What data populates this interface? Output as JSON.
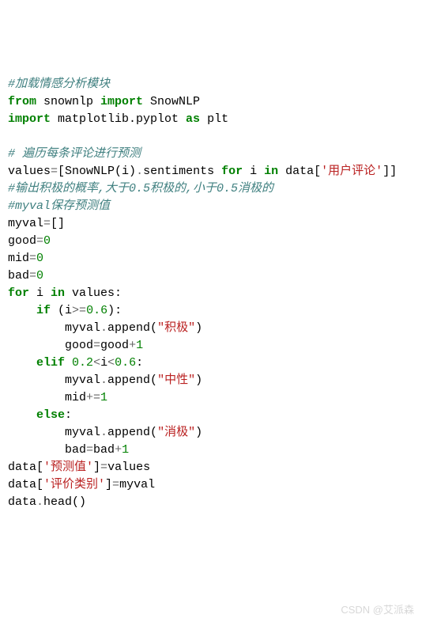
{
  "code": {
    "line1_comment": "#加载情感分析模块",
    "line2_from": "from",
    "line2_mod1": " snownlp ",
    "line2_import": "import",
    "line2_mod2": " SnowNLP",
    "line3_import": "import",
    "line3_rest": " matplotlib.pyplot ",
    "line3_as": "as",
    "line3_alias": " plt",
    "line5_comment": "# 遍历每条评论进行预测",
    "line6_a": "values",
    "line6_eq": "=",
    "line6_b": "[SnowNLP(i)",
    "line6_dot": ".",
    "line6_c": "sentiments ",
    "line6_for": "for",
    "line6_d": " i ",
    "line6_in": "in",
    "line6_e": " data[",
    "line6_str": "'用户评论'",
    "line6_f": "]]",
    "line7_comment": "#输出积极的概率,大于0.5积极的,小于0.5消极的",
    "line8_comment": "#myval保存预测值",
    "line9_a": "myval",
    "line9_eq": "=",
    "line9_b": "[]",
    "line10_a": "good",
    "line10_eq": "=",
    "line10_b": "0",
    "line11_a": "mid",
    "line11_eq": "=",
    "line11_b": "0",
    "line12_a": "bad",
    "line12_eq": "=",
    "line12_b": "0",
    "line13_for": "for",
    "line13_a": " i ",
    "line13_in": "in",
    "line13_b": " values:",
    "line14_if": "if",
    "line14_a": " (i",
    "line14_op": ">=",
    "line14_num": "0.6",
    "line14_b": "):",
    "line15_a": "myval",
    "line15_dot": ".",
    "line15_b": "append(",
    "line15_str": "\"积极\"",
    "line15_c": ")",
    "line16_a": "good",
    "line16_eq": "=",
    "line16_b": "good",
    "line16_plus": "+",
    "line16_num": "1",
    "line17_elif": "elif",
    "line17_a": " ",
    "line17_num1": "0.2",
    "line17_op1": "<",
    "line17_b": "i",
    "line17_op2": "<",
    "line17_num2": "0.6",
    "line17_c": ":",
    "line18_a": "myval",
    "line18_dot": ".",
    "line18_b": "append(",
    "line18_str": "\"中性\"",
    "line18_c": ")",
    "line19_a": "mid",
    "line19_op": "+=",
    "line19_num": "1",
    "line20_else": "else",
    "line20_a": ":",
    "line21_a": "myval",
    "line21_dot": ".",
    "line21_b": "append(",
    "line21_str": "\"消极\"",
    "line21_c": ")",
    "line22_a": "bad",
    "line22_eq": "=",
    "line22_b": "bad",
    "line22_plus": "+",
    "line22_num": "1",
    "line23_a": "data[",
    "line23_str": "'预测值'",
    "line23_b": "]",
    "line23_eq": "=",
    "line23_c": "values",
    "line24_a": "data[",
    "line24_str": "'评价类别'",
    "line24_b": "]",
    "line24_eq": "=",
    "line24_c": "myval",
    "line25_a": "data",
    "line25_dot": ".",
    "line25_b": "head()"
  },
  "watermark": "CSDN @艾派森"
}
